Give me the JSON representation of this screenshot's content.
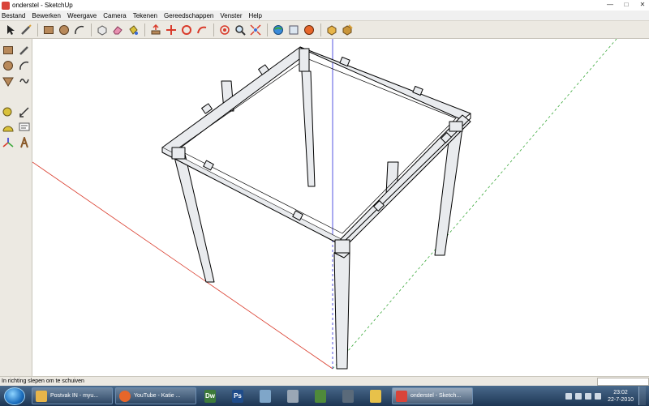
{
  "window": {
    "title": "onderstel - SketchUp"
  },
  "menu": [
    "Bestand",
    "Bewerken",
    "Weergave",
    "Camera",
    "Tekenen",
    "Gereedschappen",
    "Venster",
    "Help"
  ],
  "toolbar_icons": [
    "select-icon",
    "line-icon",
    "rectangle-icon",
    "circle-icon",
    "arc-icon",
    "make-component-icon",
    "eraser-icon",
    "paint-bucket-icon",
    "push-pull-icon",
    "move-icon",
    "rotate-icon",
    "follow-me-icon",
    "orbit-icon",
    "zoom-icon",
    "zoom-extents-icon",
    "get-models-icon",
    "share-model-icon",
    "google-earth-icon",
    "component-icon",
    "dynamic-component-icon"
  ],
  "palette_icons": [
    "rectangle-icon",
    "line-icon",
    "circle-icon",
    "arc-icon",
    "polygon-icon",
    "freehand-icon",
    "tape-measure-icon",
    "dimension-icon",
    "protractor-icon",
    "text-icon",
    "axes-icon",
    "3d-text-icon"
  ],
  "status": {
    "hint": "In richting slepen om te schuiven"
  },
  "taskbar": {
    "items": [
      {
        "label": "Postvak IN - myu...",
        "icon": "outlook-icon",
        "color": "#e7b54a"
      },
      {
        "label": "YouTube - Katie ...",
        "icon": "firefox-icon",
        "color": "#e7662a"
      },
      {
        "label": "onderstel - Sketch...",
        "icon": "sketchup-icon",
        "color": "#d9443a"
      }
    ],
    "pinned": [
      {
        "label": "Dw",
        "icon": "dreamweaver-icon",
        "color": "#3d7a3a"
      },
      {
        "label": "Ps",
        "icon": "photoshop-icon",
        "color": "#1f4c8a"
      }
    ],
    "clock_time": "23:02",
    "clock_date": "22-7-2010"
  },
  "colors": {
    "axis_red": "#d93a2a",
    "axis_green": "#3aa83a",
    "axis_blue": "#2a2ad9",
    "wood_face": "#e9ebee",
    "wood_edge": "#000000"
  }
}
